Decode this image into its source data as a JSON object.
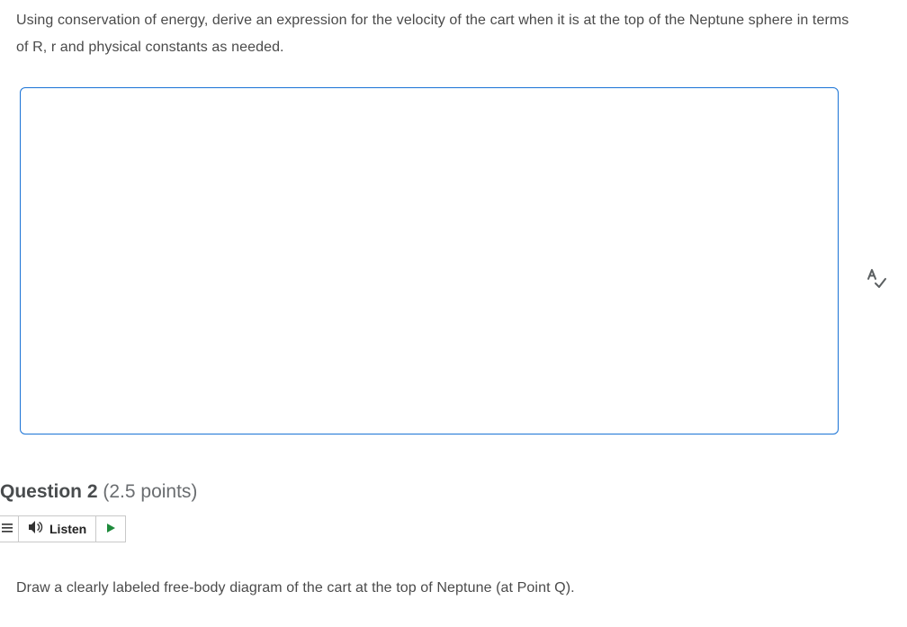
{
  "question1": {
    "prompt": "Using conservation of energy, derive an expression for the velocity of the cart when it is at the top of the Neptune sphere in terms of R, r and physical constants as needed."
  },
  "question2": {
    "label_prefix": "Question 2",
    "points_text": " (2.5 points)",
    "listen_label": "Listen",
    "prompt": "Draw a clearly labeled free-body diagram of the cart at the top of Neptune (at Point Q)."
  }
}
